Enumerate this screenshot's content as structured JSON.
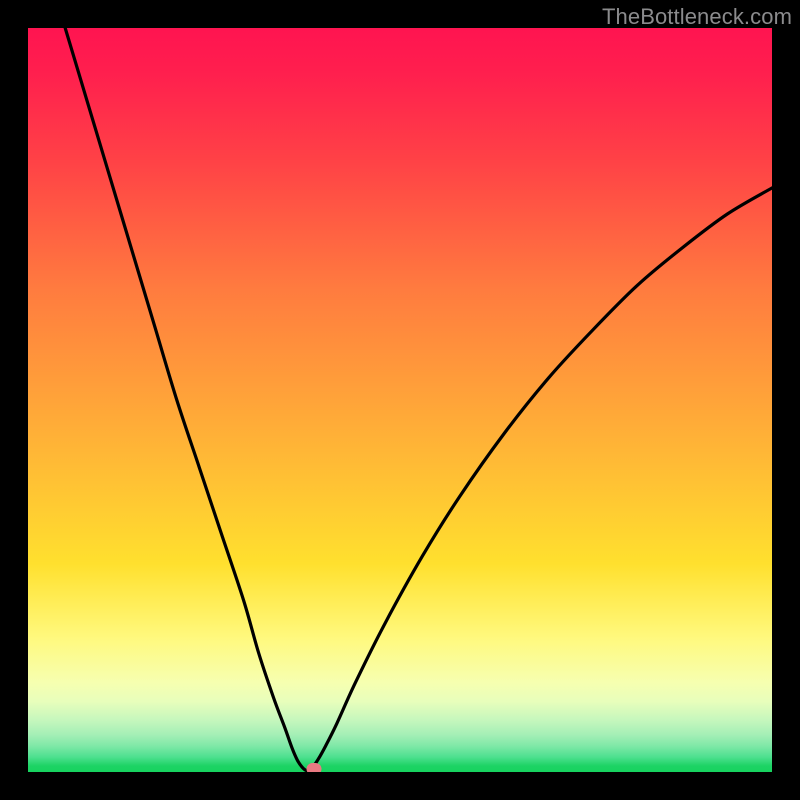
{
  "watermark": "TheBottleneck.com",
  "chart_data": {
    "type": "line",
    "title": "",
    "xlabel": "",
    "ylabel": "",
    "xlim": [
      0,
      100
    ],
    "ylim": [
      0,
      100
    ],
    "series": [
      {
        "name": "bottleneck-curve",
        "x": [
          5,
          8,
          11,
          14,
          17,
          20,
          23,
          26,
          29,
          31,
          33,
          34.5,
          35.5,
          36.2,
          36.8,
          37.3,
          37.8,
          38.3,
          39,
          40,
          41.5,
          44,
          48,
          53,
          58,
          64,
          70,
          76,
          82,
          88,
          94,
          100
        ],
        "y": [
          100,
          90,
          80,
          70,
          60,
          50,
          41,
          32,
          23,
          16,
          10,
          6,
          3.2,
          1.6,
          0.7,
          0.25,
          0.25,
          0.7,
          1.7,
          3.5,
          6.5,
          12,
          20,
          29,
          37,
          45.5,
          53,
          59.5,
          65.5,
          70.5,
          75,
          78.5
        ]
      }
    ],
    "marker": {
      "x_pct": 38.5,
      "y_pct": 0.4,
      "color": "#e87a82"
    },
    "palette": {
      "frame": "#000000",
      "curve": "#000000",
      "top": "#ff1450",
      "bottom": "#17d35f"
    }
  }
}
